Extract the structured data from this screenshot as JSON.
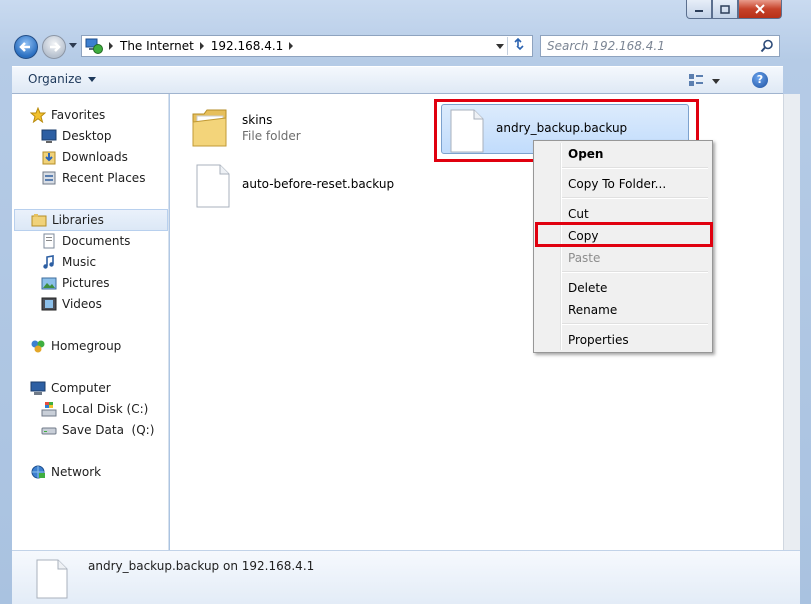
{
  "address": {
    "crumbs": [
      "The Internet",
      "192.168.4.1"
    ]
  },
  "search": {
    "placeholder": "Search 192.168.4.1"
  },
  "toolbar": {
    "organize_label": "Organize",
    "help_label": "?"
  },
  "nav": {
    "favorites": {
      "label": "Favorites",
      "items": [
        "Desktop",
        "Downloads",
        "Recent Places"
      ]
    },
    "libraries": {
      "label": "Libraries",
      "items": [
        "Documents",
        "Music",
        "Pictures",
        "Videos"
      ]
    },
    "homegroup": {
      "label": "Homegroup"
    },
    "computer": {
      "label": "Computer",
      "items": [
        "Local Disk (C:)",
        "Save Data  (Q:)"
      ]
    },
    "network": {
      "label": "Network"
    }
  },
  "files": [
    {
      "name": "skins",
      "type": "File folder"
    },
    {
      "name": "auto-before-reset.backup"
    },
    {
      "name": "andry_backup.backup"
    }
  ],
  "context_menu": {
    "open": "Open",
    "copy_to_folder": "Copy To Folder...",
    "cut": "Cut",
    "copy": "Copy",
    "paste": "Paste",
    "delete": "Delete",
    "rename": "Rename",
    "properties": "Properties"
  },
  "details": {
    "text": "andry_backup.backup on 192.168.4.1"
  },
  "colors": {
    "highlight": "#e0000f",
    "selection": "#c1dcfc"
  }
}
